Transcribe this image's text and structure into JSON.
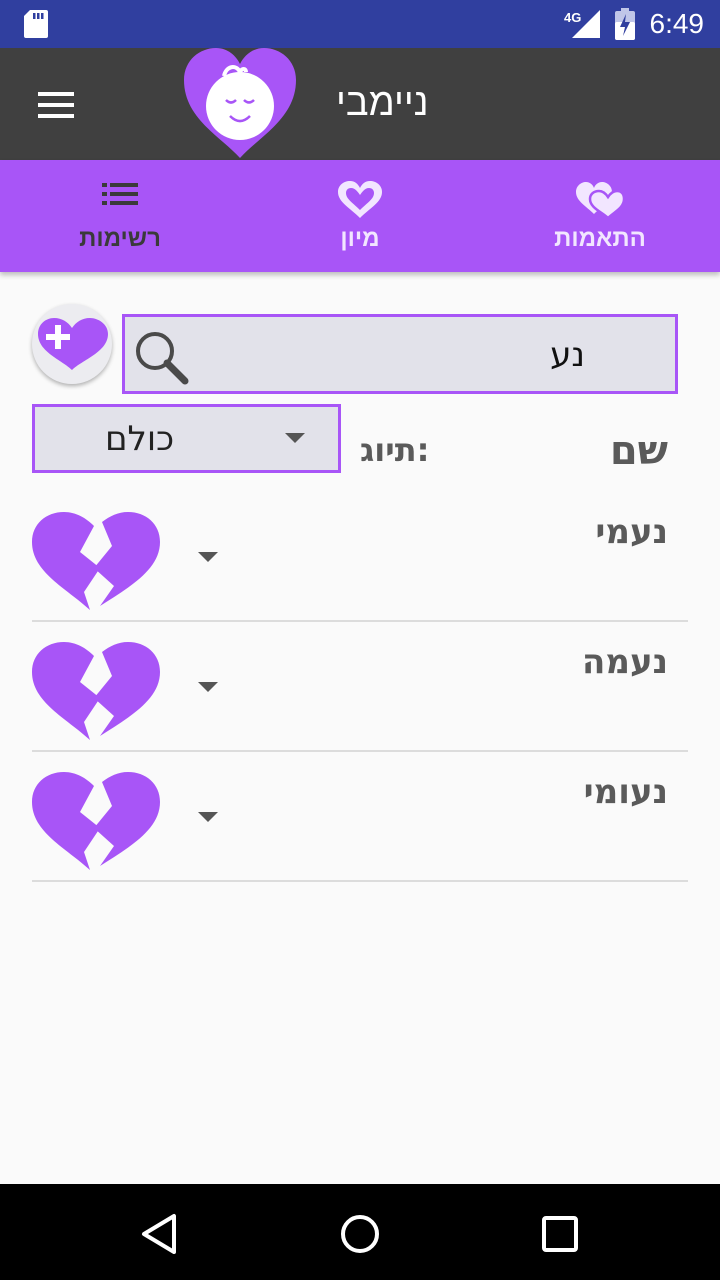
{
  "status_bar": {
    "time": "6:49",
    "network": "4G",
    "icons": [
      "sd-card-icon",
      "signal-icon",
      "battery-icon"
    ]
  },
  "app_bar": {
    "title": "ניימבי",
    "menu_icon": "hamburger-menu-icon",
    "logo_icon": "baby-heart-logo-icon"
  },
  "tabs": [
    {
      "label": "רשימות",
      "icon": "list-icon",
      "active": true
    },
    {
      "label": "מיון",
      "icon": "heart-outline-icon",
      "active": false
    },
    {
      "label": "התאמות",
      "icon": "double-heart-icon",
      "active": false
    }
  ],
  "search": {
    "value": "נע",
    "icon": "search-icon"
  },
  "add_button": {
    "icon": "heart-plus-icon"
  },
  "filter": {
    "label": "תיוג:",
    "value": "כולם"
  },
  "list_header": {
    "name_label": "שם"
  },
  "names": [
    {
      "name": "נעמי",
      "icon": "broken-heart-icon"
    },
    {
      "name": "נעמה",
      "icon": "broken-heart-icon"
    },
    {
      "name": "נעומי",
      "icon": "broken-heart-icon"
    }
  ],
  "nav_bar": {
    "icons": [
      "back-icon",
      "home-icon",
      "recents-icon"
    ]
  },
  "colors": {
    "accent": "#a855f7",
    "status_bar": "#303f9f",
    "app_bar": "#404040",
    "field_bg": "#e2e2ea"
  }
}
